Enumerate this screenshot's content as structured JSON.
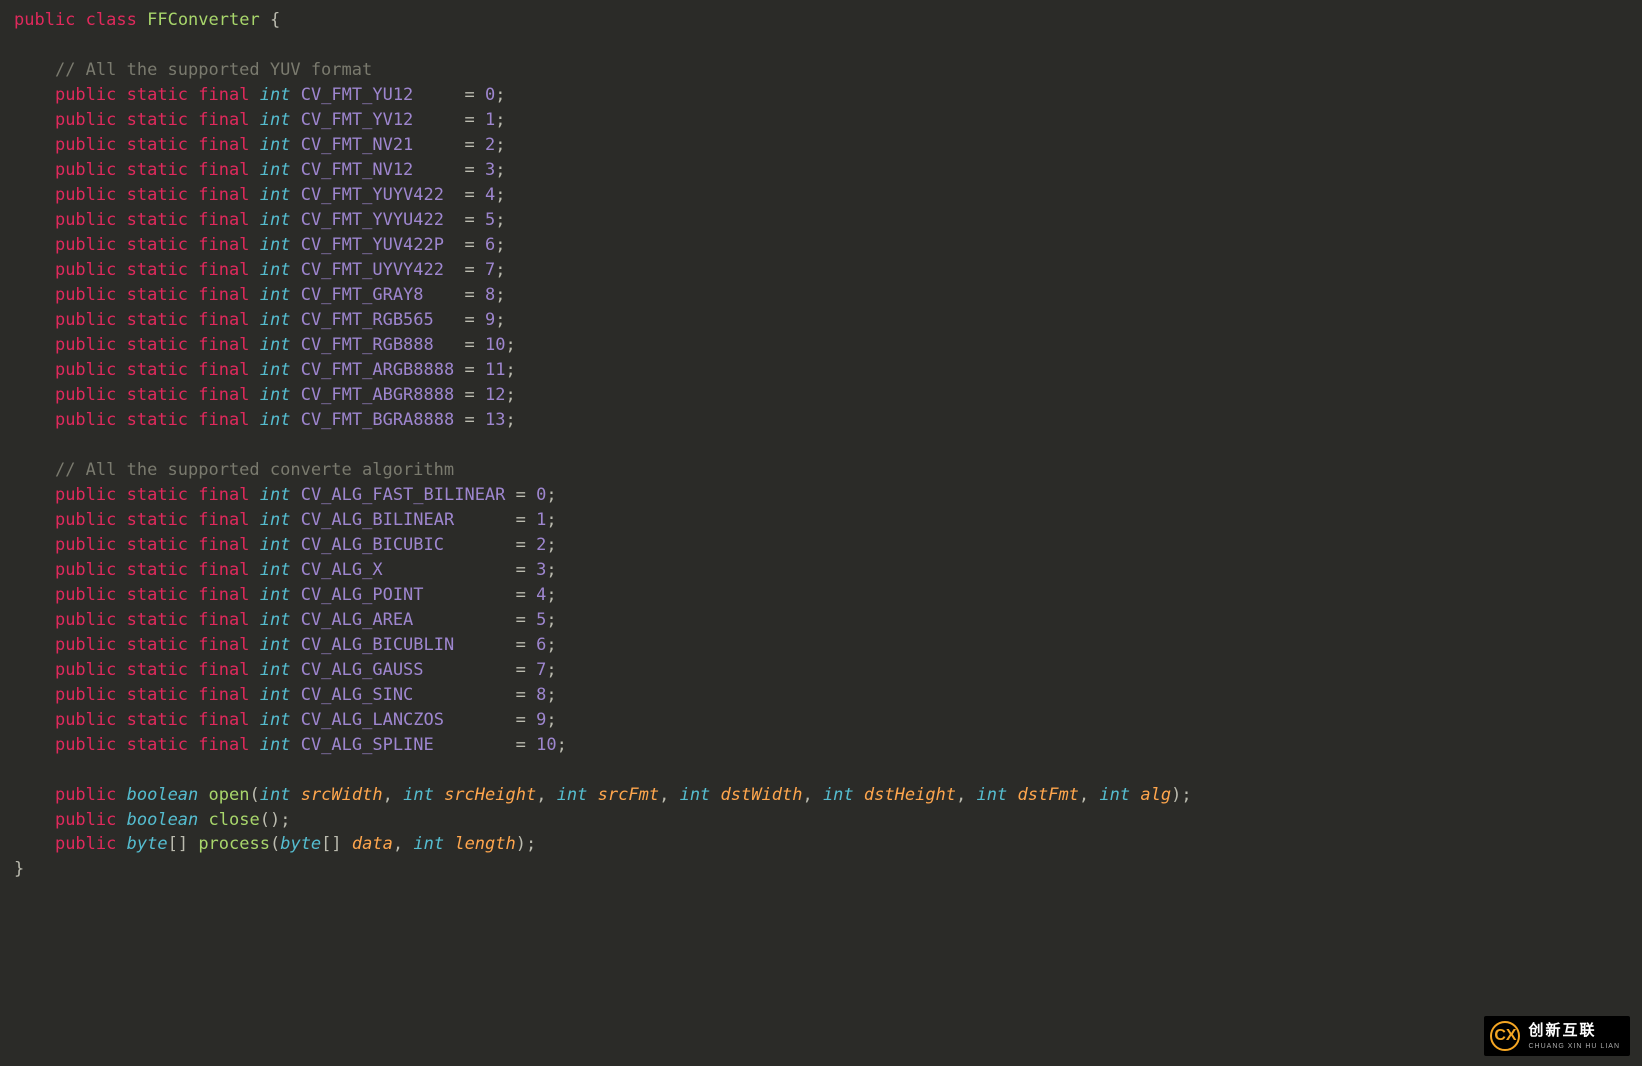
{
  "code": {
    "classDecl": {
      "public": "public",
      "class": "class",
      "name": "FFConverter",
      "open": "{"
    },
    "comment1": "// All the supported YUV format",
    "fmts": [
      {
        "pub": "public",
        "stat": "static",
        "fin": "final",
        "type": "int",
        "name": "CV_FMT_YU12",
        "pad": "    ",
        "eq": "=",
        "val": "0",
        "semi": ";"
      },
      {
        "pub": "public",
        "stat": "static",
        "fin": "final",
        "type": "int",
        "name": "CV_FMT_YV12",
        "pad": "    ",
        "eq": "=",
        "val": "1",
        "semi": ";"
      },
      {
        "pub": "public",
        "stat": "static",
        "fin": "final",
        "type": "int",
        "name": "CV_FMT_NV21",
        "pad": "    ",
        "eq": "=",
        "val": "2",
        "semi": ";"
      },
      {
        "pub": "public",
        "stat": "static",
        "fin": "final",
        "type": "int",
        "name": "CV_FMT_NV12",
        "pad": "    ",
        "eq": "=",
        "val": "3",
        "semi": ";"
      },
      {
        "pub": "public",
        "stat": "static",
        "fin": "final",
        "type": "int",
        "name": "CV_FMT_YUYV422",
        "pad": " ",
        "eq": "=",
        "val": "4",
        "semi": ";"
      },
      {
        "pub": "public",
        "stat": "static",
        "fin": "final",
        "type": "int",
        "name": "CV_FMT_YVYU422",
        "pad": " ",
        "eq": "=",
        "val": "5",
        "semi": ";"
      },
      {
        "pub": "public",
        "stat": "static",
        "fin": "final",
        "type": "int",
        "name": "CV_FMT_YUV422P",
        "pad": " ",
        "eq": "=",
        "val": "6",
        "semi": ";"
      },
      {
        "pub": "public",
        "stat": "static",
        "fin": "final",
        "type": "int",
        "name": "CV_FMT_UYVY422",
        "pad": " ",
        "eq": "=",
        "val": "7",
        "semi": ";"
      },
      {
        "pub": "public",
        "stat": "static",
        "fin": "final",
        "type": "int",
        "name": "CV_FMT_GRAY8",
        "pad": "   ",
        "eq": "=",
        "val": "8",
        "semi": ";"
      },
      {
        "pub": "public",
        "stat": "static",
        "fin": "final",
        "type": "int",
        "name": "CV_FMT_RGB565",
        "pad": "  ",
        "eq": "=",
        "val": "9",
        "semi": ";"
      },
      {
        "pub": "public",
        "stat": "static",
        "fin": "final",
        "type": "int",
        "name": "CV_FMT_RGB888",
        "pad": "  ",
        "eq": "=",
        "val": "10",
        "semi": ";"
      },
      {
        "pub": "public",
        "stat": "static",
        "fin": "final",
        "type": "int",
        "name": "CV_FMT_ARGB8888",
        "pad": "",
        "eq": "=",
        "val": "11",
        "semi": ";"
      },
      {
        "pub": "public",
        "stat": "static",
        "fin": "final",
        "type": "int",
        "name": "CV_FMT_ABGR8888",
        "pad": "",
        "eq": "=",
        "val": "12",
        "semi": ";"
      },
      {
        "pub": "public",
        "stat": "static",
        "fin": "final",
        "type": "int",
        "name": "CV_FMT_BGRA8888",
        "pad": "",
        "eq": "=",
        "val": "13",
        "semi": ";"
      }
    ],
    "comment2": "// All the supported converte algorithm",
    "algs": [
      {
        "pub": "public",
        "stat": "static",
        "fin": "final",
        "type": "int",
        "name": "CV_ALG_FAST_BILINEAR",
        "pad": "",
        "eq": "=",
        "val": "0",
        "semi": ";"
      },
      {
        "pub": "public",
        "stat": "static",
        "fin": "final",
        "type": "int",
        "name": "CV_ALG_BILINEAR",
        "pad": "     ",
        "eq": "=",
        "val": "1",
        "semi": ";"
      },
      {
        "pub": "public",
        "stat": "static",
        "fin": "final",
        "type": "int",
        "name": "CV_ALG_BICUBIC",
        "pad": "      ",
        "eq": "=",
        "val": "2",
        "semi": ";"
      },
      {
        "pub": "public",
        "stat": "static",
        "fin": "final",
        "type": "int",
        "name": "CV_ALG_X",
        "pad": "            ",
        "eq": "=",
        "val": "3",
        "semi": ";"
      },
      {
        "pub": "public",
        "stat": "static",
        "fin": "final",
        "type": "int",
        "name": "CV_ALG_POINT",
        "pad": "        ",
        "eq": "=",
        "val": "4",
        "semi": ";"
      },
      {
        "pub": "public",
        "stat": "static",
        "fin": "final",
        "type": "int",
        "name": "CV_ALG_AREA",
        "pad": "         ",
        "eq": "=",
        "val": "5",
        "semi": ";"
      },
      {
        "pub": "public",
        "stat": "static",
        "fin": "final",
        "type": "int",
        "name": "CV_ALG_BICUBLIN",
        "pad": "     ",
        "eq": "=",
        "val": "6",
        "semi": ";"
      },
      {
        "pub": "public",
        "stat": "static",
        "fin": "final",
        "type": "int",
        "name": "CV_ALG_GAUSS",
        "pad": "        ",
        "eq": "=",
        "val": "7",
        "semi": ";"
      },
      {
        "pub": "public",
        "stat": "static",
        "fin": "final",
        "type": "int",
        "name": "CV_ALG_SINC",
        "pad": "         ",
        "eq": "=",
        "val": "8",
        "semi": ";"
      },
      {
        "pub": "public",
        "stat": "static",
        "fin": "final",
        "type": "int",
        "name": "CV_ALG_LANCZOS",
        "pad": "      ",
        "eq": "=",
        "val": "9",
        "semi": ";"
      },
      {
        "pub": "public",
        "stat": "static",
        "fin": "final",
        "type": "int",
        "name": "CV_ALG_SPLINE",
        "pad": "       ",
        "eq": "=",
        "val": "10",
        "semi": ";"
      }
    ],
    "methods": {
      "open": {
        "pub": "public",
        "ret": "boolean",
        "name": "open",
        "lp": "(",
        "params": [
          {
            "type": "int",
            "name": "srcWidth"
          },
          {
            "type": "int",
            "name": "srcHeight"
          },
          {
            "type": "int",
            "name": "srcFmt"
          },
          {
            "type": "int",
            "name": "dstWidth"
          },
          {
            "type": "int",
            "name": "dstHeight"
          },
          {
            "type": "int",
            "name": "dstFmt"
          },
          {
            "type": "int",
            "name": "alg"
          }
        ],
        "rp": ")",
        "semi": ";"
      },
      "close": {
        "pub": "public",
        "ret": "boolean",
        "name": "close",
        "lp": "(",
        "rp": ")",
        "semi": ";"
      },
      "process": {
        "pub": "public",
        "ret": "byte",
        "brackets": "[]",
        "name": "process",
        "lp": "(",
        "params": [
          {
            "type": "byte",
            "brackets": "[]",
            "name": "data"
          },
          {
            "type": "int",
            "name": "length"
          }
        ],
        "rp": ")",
        "semi": ";"
      }
    },
    "close": "}"
  },
  "watermark": {
    "cn": "创新互联",
    "en": "CHUANG XIN HU LIAN",
    "logo": "CX"
  }
}
